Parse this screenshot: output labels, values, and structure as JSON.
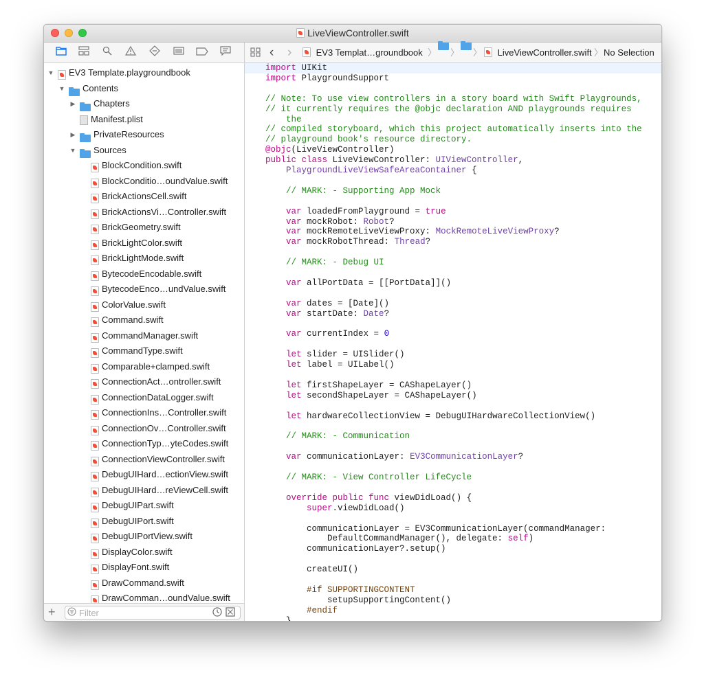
{
  "window": {
    "title": "LiveViewController.swift"
  },
  "colors": {
    "keyword": "#b50d84",
    "type": "#6f41a7",
    "comment": "#248a1a",
    "number": "#1c00cf",
    "preprocessor": "#74420c",
    "accent": "#1c7cf4"
  },
  "navigator": {
    "icons": [
      "folder-icon",
      "hierarchy-icon",
      "search-icon",
      "warning-icon",
      "diamond-icon",
      "list-icon",
      "tag-icon",
      "comment-icon"
    ],
    "tree": [
      {
        "label": "EV3 Template.playgroundbook",
        "level": 0,
        "kind": "book",
        "disclosure": "open"
      },
      {
        "label": "Contents",
        "level": 1,
        "kind": "folder",
        "disclosure": "open"
      },
      {
        "label": "Chapters",
        "level": 2,
        "kind": "folder",
        "disclosure": "closed"
      },
      {
        "label": "Manifest.plist",
        "level": 2,
        "kind": "plist",
        "disclosure": "none"
      },
      {
        "label": "PrivateResources",
        "level": 2,
        "kind": "folder",
        "disclosure": "closed"
      },
      {
        "label": "Sources",
        "level": 2,
        "kind": "folder",
        "disclosure": "open"
      },
      {
        "label": "BlockCondition.swift",
        "level": 3,
        "kind": "swift",
        "disclosure": "none"
      },
      {
        "label": "BlockConditio…oundValue.swift",
        "level": 3,
        "kind": "swift",
        "disclosure": "none"
      },
      {
        "label": "BrickActionsCell.swift",
        "level": 3,
        "kind": "swift",
        "disclosure": "none"
      },
      {
        "label": "BrickActionsVi…Controller.swift",
        "level": 3,
        "kind": "swift",
        "disclosure": "none"
      },
      {
        "label": "BrickGeometry.swift",
        "level": 3,
        "kind": "swift",
        "disclosure": "none"
      },
      {
        "label": "BrickLightColor.swift",
        "level": 3,
        "kind": "swift",
        "disclosure": "none"
      },
      {
        "label": "BrickLightMode.swift",
        "level": 3,
        "kind": "swift",
        "disclosure": "none"
      },
      {
        "label": "BytecodeEncodable.swift",
        "level": 3,
        "kind": "swift",
        "disclosure": "none"
      },
      {
        "label": "BytecodeEnco…undValue.swift",
        "level": 3,
        "kind": "swift",
        "disclosure": "none"
      },
      {
        "label": "ColorValue.swift",
        "level": 3,
        "kind": "swift",
        "disclosure": "none"
      },
      {
        "label": "Command.swift",
        "level": 3,
        "kind": "swift",
        "disclosure": "none"
      },
      {
        "label": "CommandManager.swift",
        "level": 3,
        "kind": "swift",
        "disclosure": "none"
      },
      {
        "label": "CommandType.swift",
        "level": 3,
        "kind": "swift",
        "disclosure": "none"
      },
      {
        "label": "Comparable+clamped.swift",
        "level": 3,
        "kind": "swift",
        "disclosure": "none"
      },
      {
        "label": "ConnectionAct…ontroller.swift",
        "level": 3,
        "kind": "swift",
        "disclosure": "none"
      },
      {
        "label": "ConnectionDataLogger.swift",
        "level": 3,
        "kind": "swift",
        "disclosure": "none"
      },
      {
        "label": "ConnectionIns…Controller.swift",
        "level": 3,
        "kind": "swift",
        "disclosure": "none"
      },
      {
        "label": "ConnectionOv…Controller.swift",
        "level": 3,
        "kind": "swift",
        "disclosure": "none"
      },
      {
        "label": "ConnectionTyp…yteCodes.swift",
        "level": 3,
        "kind": "swift",
        "disclosure": "none"
      },
      {
        "label": "ConnectionViewController.swift",
        "level": 3,
        "kind": "swift",
        "disclosure": "none"
      },
      {
        "label": "DebugUIHard…ectionView.swift",
        "level": 3,
        "kind": "swift",
        "disclosure": "none"
      },
      {
        "label": "DebugUIHard…reViewCell.swift",
        "level": 3,
        "kind": "swift",
        "disclosure": "none"
      },
      {
        "label": "DebugUIPart.swift",
        "level": 3,
        "kind": "swift",
        "disclosure": "none"
      },
      {
        "label": "DebugUIPort.swift",
        "level": 3,
        "kind": "swift",
        "disclosure": "none"
      },
      {
        "label": "DebugUIPortView.swift",
        "level": 3,
        "kind": "swift",
        "disclosure": "none"
      },
      {
        "label": "DisplayColor.swift",
        "level": 3,
        "kind": "swift",
        "disclosure": "none"
      },
      {
        "label": "DisplayFont.swift",
        "level": 3,
        "kind": "swift",
        "disclosure": "none"
      },
      {
        "label": "DrawCommand.swift",
        "level": 3,
        "kind": "swift",
        "disclosure": "none"
      },
      {
        "label": "DrawComman…oundValue.swift",
        "level": 3,
        "kind": "swift",
        "disclosure": "none"
      }
    ],
    "filter": {
      "placeholder": "Filter",
      "value": "",
      "add_label": "+"
    }
  },
  "jumpbar": {
    "grid_icon": "grid-icon",
    "back": "‹",
    "forward": "›",
    "project": "EV3 Templat…groundbook",
    "file": "LiveViewController.swift",
    "selection": "No Selection"
  },
  "editor": {
    "lines": [
      [
        [
          "k",
          "import"
        ],
        [
          "p",
          " UIKit"
        ]
      ],
      [
        [
          "k",
          "import"
        ],
        [
          "p",
          " PlaygroundSupport"
        ]
      ],
      [],
      [
        [
          "c",
          "// Note: To use view controllers in a story board with Swift Playgrounds,"
        ]
      ],
      [
        [
          "c",
          "// it currently requires the @objc declaration AND playgrounds requires"
        ]
      ],
      [
        [
          "c",
          "    the"
        ]
      ],
      [
        [
          "c",
          "// compiled storyboard, which this project automatically inserts into the"
        ]
      ],
      [
        [
          "c",
          "// playground book's resource directory."
        ]
      ],
      [
        [
          "k",
          "@objc"
        ],
        [
          "p",
          "(LiveViewController)"
        ]
      ],
      [
        [
          "k",
          "public class"
        ],
        [
          "p",
          " LiveViewController: "
        ],
        [
          "t",
          "UIViewController"
        ],
        [
          "p",
          ","
        ]
      ],
      [
        [
          "p",
          "    "
        ],
        [
          "t",
          "PlaygroundLiveViewSafeAreaContainer"
        ],
        [
          "p",
          " {"
        ]
      ],
      [],
      [
        [
          "c",
          "    // MARK: - Supporting App Mock"
        ]
      ],
      [],
      [
        [
          "p",
          "    "
        ],
        [
          "k",
          "var"
        ],
        [
          "p",
          " loadedFromPlayground = "
        ],
        [
          "k",
          "true"
        ]
      ],
      [
        [
          "p",
          "    "
        ],
        [
          "k",
          "var"
        ],
        [
          "p",
          " mockRobot: "
        ],
        [
          "t",
          "Robot"
        ],
        [
          "p",
          "?"
        ]
      ],
      [
        [
          "p",
          "    "
        ],
        [
          "k",
          "var"
        ],
        [
          "p",
          " mockRemoteLiveViewProxy: "
        ],
        [
          "t",
          "MockRemoteLiveViewProxy"
        ],
        [
          "p",
          "?"
        ]
      ],
      [
        [
          "p",
          "    "
        ],
        [
          "k",
          "var"
        ],
        [
          "p",
          " mockRobotThread: "
        ],
        [
          "t",
          "Thread"
        ],
        [
          "p",
          "?"
        ]
      ],
      [],
      [
        [
          "c",
          "    // MARK: - Debug UI"
        ]
      ],
      [],
      [
        [
          "p",
          "    "
        ],
        [
          "k",
          "var"
        ],
        [
          "p",
          " allPortData = [[PortData]]()"
        ]
      ],
      [],
      [
        [
          "p",
          "    "
        ],
        [
          "k",
          "var"
        ],
        [
          "p",
          " dates = [Date]()"
        ]
      ],
      [
        [
          "p",
          "    "
        ],
        [
          "k",
          "var"
        ],
        [
          "p",
          " startDate: "
        ],
        [
          "t",
          "Date"
        ],
        [
          "p",
          "?"
        ]
      ],
      [],
      [
        [
          "p",
          "    "
        ],
        [
          "k",
          "var"
        ],
        [
          "p",
          " currentIndex = "
        ],
        [
          "n",
          "0"
        ]
      ],
      [],
      [
        [
          "p",
          "    "
        ],
        [
          "k",
          "let"
        ],
        [
          "p",
          " slider = UISlider()"
        ]
      ],
      [
        [
          "p",
          "    "
        ],
        [
          "k",
          "let"
        ],
        [
          "p",
          " label = UILabel()"
        ]
      ],
      [],
      [
        [
          "p",
          "    "
        ],
        [
          "k",
          "let"
        ],
        [
          "p",
          " firstShapeLayer = CAShapeLayer()"
        ]
      ],
      [
        [
          "p",
          "    "
        ],
        [
          "k",
          "let"
        ],
        [
          "p",
          " secondShapeLayer = CAShapeLayer()"
        ]
      ],
      [],
      [
        [
          "p",
          "    "
        ],
        [
          "k",
          "let"
        ],
        [
          "p",
          " hardwareCollectionView = DebugUIHardwareCollectionView()"
        ]
      ],
      [],
      [
        [
          "c",
          "    // MARK: - Communication"
        ]
      ],
      [],
      [
        [
          "p",
          "    "
        ],
        [
          "k",
          "var"
        ],
        [
          "p",
          " communicationLayer: "
        ],
        [
          "t",
          "EV3CommunicationLayer"
        ],
        [
          "p",
          "?"
        ]
      ],
      [],
      [
        [
          "c",
          "    // MARK: - View Controller LifeCycle"
        ]
      ],
      [],
      [
        [
          "p",
          "    "
        ],
        [
          "k",
          "override public func"
        ],
        [
          "p",
          " viewDidLoad() {"
        ]
      ],
      [
        [
          "p",
          "        "
        ],
        [
          "k",
          "super"
        ],
        [
          "p",
          ".viewDidLoad()"
        ]
      ],
      [],
      [
        [
          "p",
          "        communicationLayer = EV3CommunicationLayer(commandManager:"
        ]
      ],
      [
        [
          "p",
          "            DefaultCommandManager(), delegate: "
        ],
        [
          "k",
          "self"
        ],
        [
          "p",
          ")"
        ]
      ],
      [
        [
          "p",
          "        communicationLayer?.setup()"
        ]
      ],
      [],
      [
        [
          "p",
          "        createUI()"
        ]
      ],
      [],
      [
        [
          "r",
          "        #if SUPPORTINGCONTENT"
        ]
      ],
      [
        [
          "p",
          "            setupSupportingContent()"
        ]
      ],
      [
        [
          "r",
          "        #endif"
        ]
      ],
      [
        [
          "p",
          "    }"
        ]
      ]
    ]
  }
}
